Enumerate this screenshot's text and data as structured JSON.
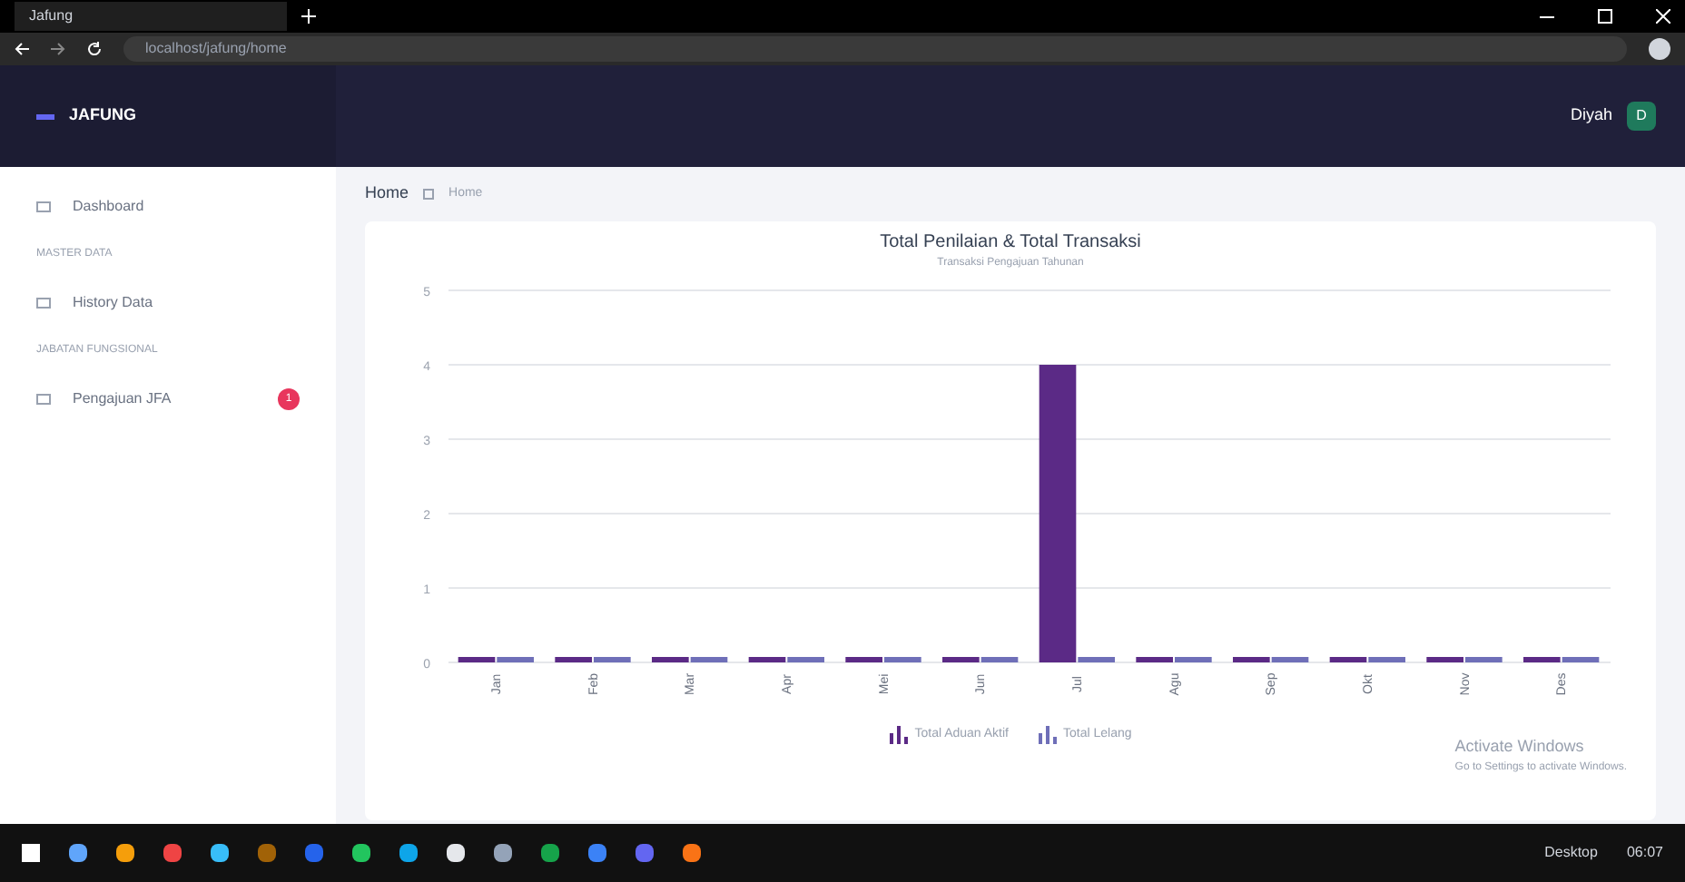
{
  "browser": {
    "tab_title": "Jafung",
    "address": "localhost/jafung/home"
  },
  "header": {
    "logo": "JAFUNG",
    "user": "Diyah",
    "avatar": "D"
  },
  "sidebar": {
    "items": [
      {
        "kind": "link",
        "label": "Dashboard",
        "selected": false
      },
      {
        "kind": "heading",
        "label": "MASTER DATA"
      },
      {
        "kind": "link",
        "label": "History Data",
        "selected": false
      },
      {
        "kind": "heading",
        "label": "JABATAN FUNGSIONAL"
      },
      {
        "kind": "link",
        "label": "Pengajuan JFA",
        "selected": false,
        "badge": "1"
      }
    ]
  },
  "breadcrumb": {
    "title": "Home",
    "trail": "Home"
  },
  "chart": {
    "chart_data": {
      "type": "bar",
      "title": "Total Penilaian & Total Transaksi",
      "subtitle": "Transaksi Pengajuan Tahunan",
      "categories": [
        "Jan",
        "Feb",
        "Mar",
        "Apr",
        "Mei",
        "Jun",
        "Jul",
        "Agu",
        "Sep",
        "Okt",
        "Nov",
        "Des"
      ],
      "series": [
        {
          "name": "Total Aduan Aktif",
          "color": "#5b2a86",
          "values": [
            0,
            0,
            0,
            0,
            0,
            0,
            4,
            0,
            0,
            0,
            0,
            0
          ]
        },
        {
          "name": "Total Lelang",
          "color": "#6f6fb8",
          "values": [
            0,
            0,
            0,
            0,
            0,
            0,
            0,
            0,
            0,
            0,
            0,
            0
          ]
        }
      ],
      "ylim": [
        0,
        5
      ],
      "grid": true,
      "yticks": [
        0,
        1,
        2,
        3,
        4,
        5
      ]
    }
  },
  "windows_notice": {
    "title": "Activate Windows",
    "text": "Go to Settings to activate Windows."
  },
  "taskbar": {
    "tray_label": "Desktop",
    "time": "06:07"
  }
}
